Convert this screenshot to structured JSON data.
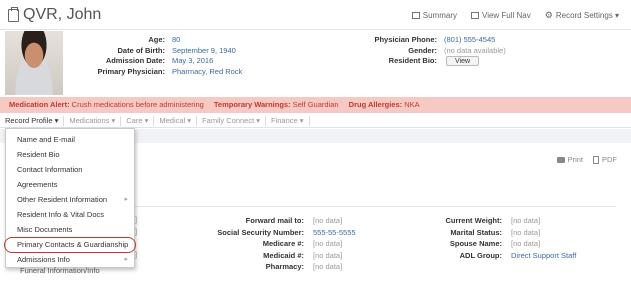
{
  "header": {
    "title": "QVR, John",
    "links": [
      {
        "label": "Summary",
        "icon": "summary-icon"
      },
      {
        "label": "View Full Nav",
        "icon": "nav-icon"
      },
      {
        "label": "Record Settings ▾",
        "icon": "gear-icon"
      }
    ]
  },
  "resident": {
    "age_label": "Age:",
    "age": "80",
    "dob_label": "Date of Birth:",
    "dob": "September 9, 1940",
    "admission_label": "Admission Date:",
    "admission": "May 3, 2016",
    "physician_label": "Primary Physician:",
    "physician": "Pharmacy, Red Rock",
    "phone_label": "Physician Phone:",
    "phone": "(801) 555-4545",
    "gender_label": "Gender:",
    "gender": "(no data available)",
    "bio_label": "Resident Bio:",
    "bio_button": "View"
  },
  "alert": {
    "med_label": "Medication Alert:",
    "med_text": "Crush medications before administering",
    "warn_label": "Temporary Warnings:",
    "warn_text": "Self Guardian",
    "allergy_label": "Drug Allergies:",
    "allergy_text": "NKA"
  },
  "tabs": [
    "Record Profile ▾",
    "Medications ▾",
    "Care ▾",
    "Medical ▾",
    "Family Connect ▾",
    "Finance ▾"
  ],
  "pdf_bar": {
    "print": "Print",
    "pdf": "PDF"
  },
  "menu": {
    "items": [
      {
        "label": "Name and E-mail",
        "submenu": false
      },
      {
        "label": "Resident Bio",
        "submenu": false
      },
      {
        "label": "Contact Information",
        "submenu": false
      },
      {
        "label": "Agreements",
        "submenu": false
      },
      {
        "label": "Other Resident Information",
        "submenu": true
      },
      {
        "label": "Resident Info & Vital Docs",
        "submenu": false
      },
      {
        "label": "Misc Documents",
        "submenu": false
      },
      {
        "label": "Primary Contacts & Guardianship",
        "submenu": false
      },
      {
        "label": "Admissions Info",
        "submenu": true
      }
    ],
    "cut_off": "Funeral Information/Info"
  },
  "details_mid": [
    {
      "label": "Forward mail to:",
      "value": "[no data]"
    },
    {
      "label": "Social Security Number:",
      "value": "555-55-5555"
    },
    {
      "label": "Medicare #:",
      "value": "[no data]"
    },
    {
      "label": "Medicaid #:",
      "value": "[no data]"
    },
    {
      "label": "Pharmacy:",
      "value": "[no data]"
    }
  ],
  "details_right": [
    {
      "label": "Current Weight:",
      "value": "[no data]"
    },
    {
      "label": "Marital Status:",
      "value": "[no data]"
    },
    {
      "label": "Spouse Name:",
      "value": "[no data]"
    },
    {
      "label": "ADL Group:",
      "value": "Direct Support Staff"
    }
  ]
}
